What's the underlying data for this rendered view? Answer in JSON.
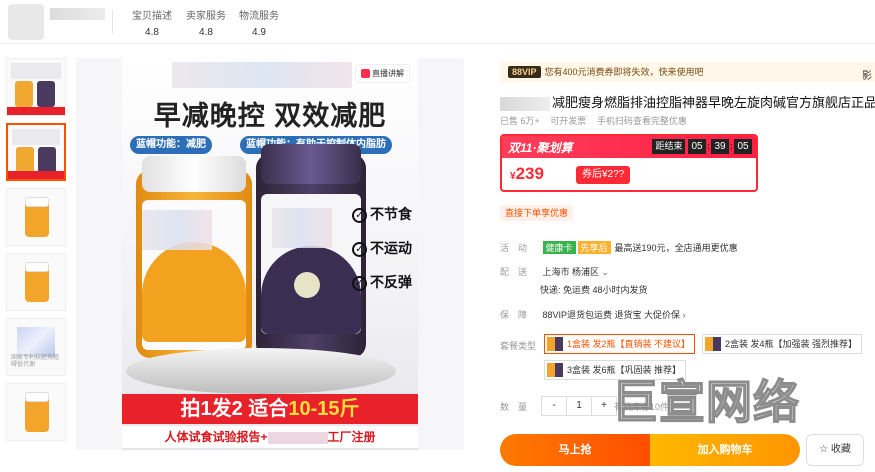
{
  "shop": {
    "scores": [
      {
        "label": "宝贝描述",
        "value": "4.8"
      },
      {
        "label": "卖家服务",
        "value": "4.8"
      },
      {
        "label": "物流服务",
        "value": "4.9"
      }
    ]
  },
  "gallery": {
    "thumb_caption": "国家专利抗肥及阻碍低代谢",
    "live_badge": "直播讲解",
    "headline": "早减晚控 双效减肥",
    "bluehat_left": "蓝帽功能：减肥",
    "bluehat_right": "蓝帽功能：有助于控制体内脂肪",
    "checks": [
      "不节食",
      "不运动",
      "不反弹"
    ],
    "band_prefix": "拍1发2 适合",
    "band_highlight": "10-15斤",
    "report_left": "人体试食试验报告+",
    "report_right": "工厂注册"
  },
  "vip": {
    "tag": "88VIP",
    "text": "您有400元消费券即将失效，快来使用吧"
  },
  "product": {
    "title": "减肥瘦身燃脂排油控脂神器早晚左旋肉碱官方旗舰店正品S",
    "sold": "已售 6万+",
    "invoice": "可开发票",
    "order_note": "手机扫码查看完整优惠"
  },
  "deal": {
    "name": "双11·聚划算",
    "countdown_label": "距结束",
    "hh": "05",
    "mm": "39",
    "ss": "05",
    "price": "239",
    "currency": "¥",
    "after_coupon": "券后¥2??"
  },
  "coupon": "直接下单享优惠",
  "rows": {
    "activity_label": "活　动",
    "activity_tag1": "健康卡",
    "activity_tag2": "先享后",
    "activity_text": "最高送190元，全店通用更优惠",
    "ship_label": "配　送",
    "ship_from": "上海市 杨浦区",
    "ship_fee": "快递: 免运费  48小时内发货",
    "guarantee_label": "保　障",
    "guarantee_text": "88VIP退货包运费 退货宝 大促价保",
    "pkg_label": "套餐类型",
    "qty_label": "数　量"
  },
  "packages": [
    "1盒装 发2瓶【直销装 不建议】",
    "2盒装 发4瓶【加强装 强烈推荐】",
    "3盒装 发6瓶【巩固装 推荐】"
  ],
  "quantity": {
    "minus": "-",
    "value": "1",
    "plus": "+",
    "stock": "有货库存10件"
  },
  "buttons": {
    "buy": "马上抢",
    "cart": "加入购物车",
    "fav": "收藏"
  },
  "watermark": "巨宣网络",
  "edge_text": "影"
}
